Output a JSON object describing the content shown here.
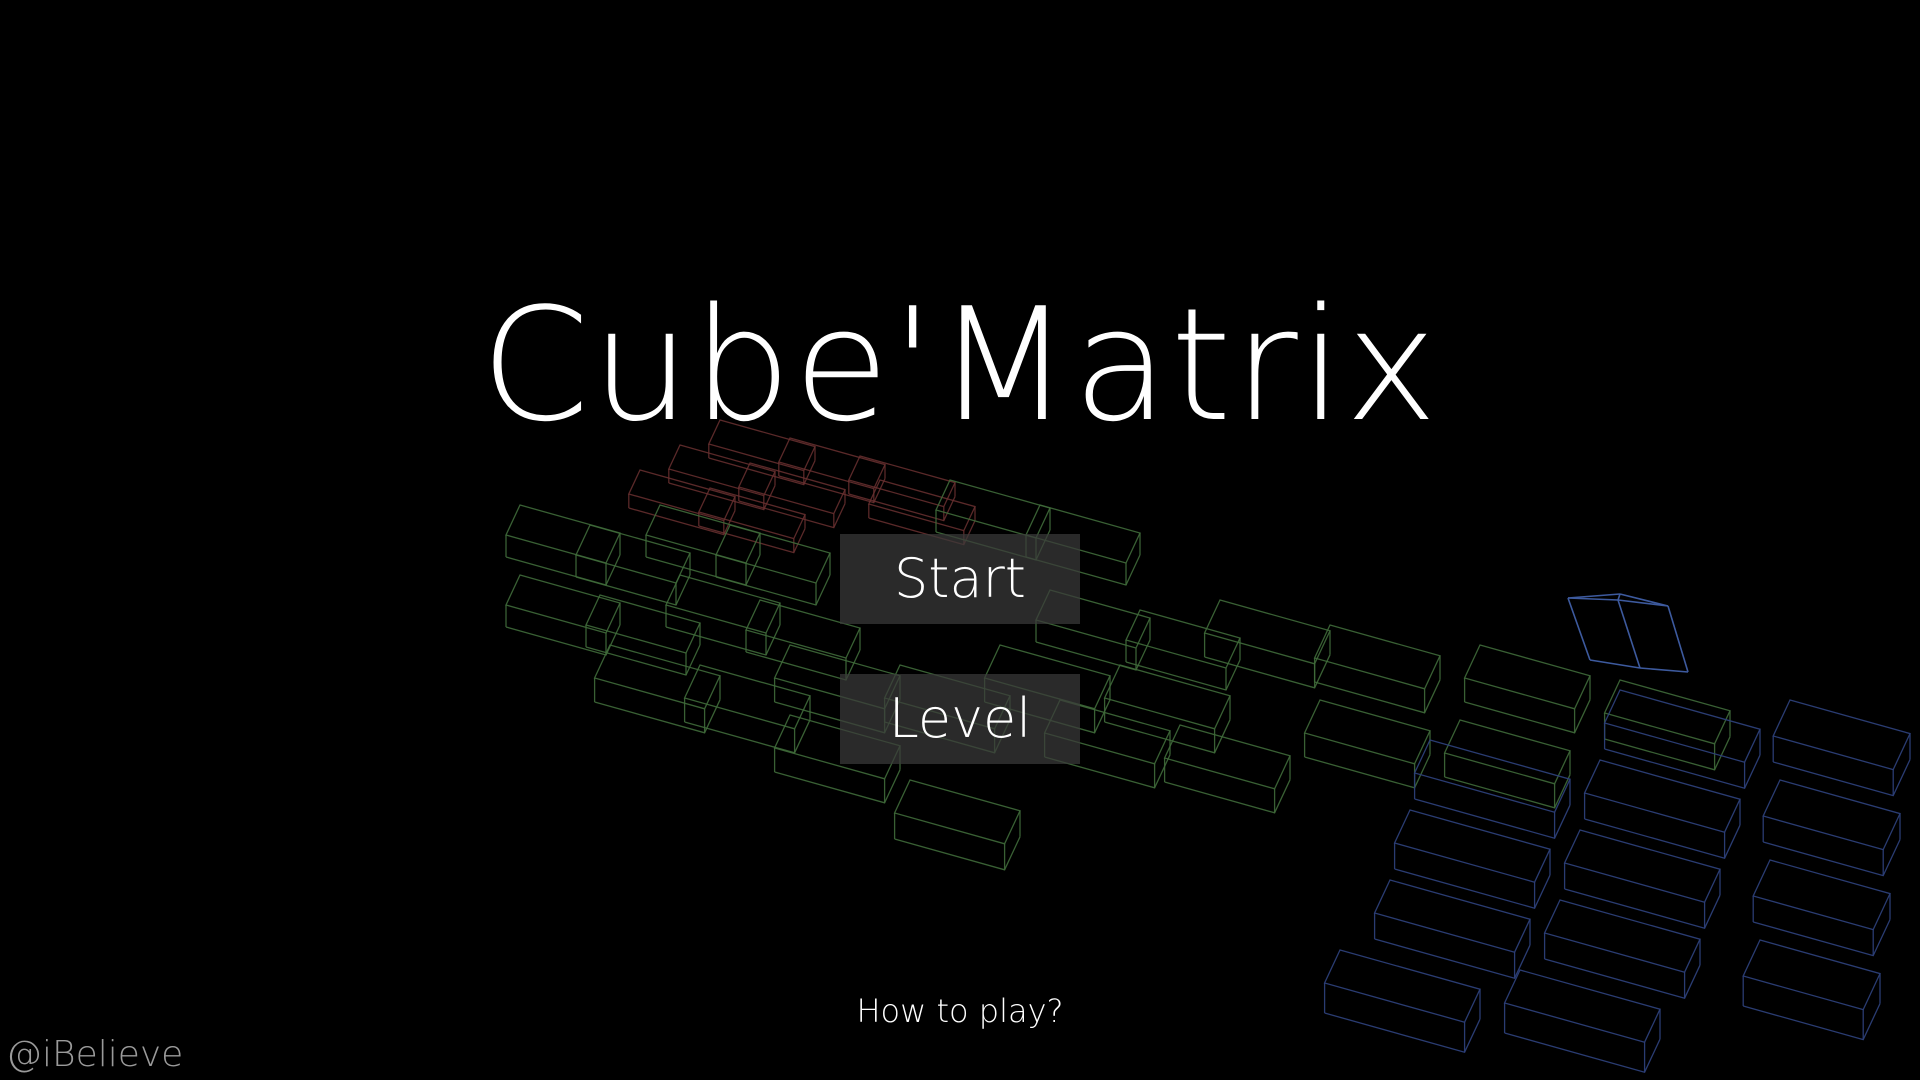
{
  "game": {
    "title": "Cube'Matrix",
    "menu": {
      "start_label": "Start",
      "level_label": "Level"
    },
    "help_link": "How to play?",
    "watermark": "@iBelieve"
  },
  "colors": {
    "background": "#000000",
    "title_text": "#ffffff",
    "button_bg": "#3a3a3a",
    "cube_red": "#6a3030",
    "cube_green": "#3f6a3a",
    "cube_blue": "#2c3f78",
    "cube_blue_bright": "#3d5a9e"
  }
}
